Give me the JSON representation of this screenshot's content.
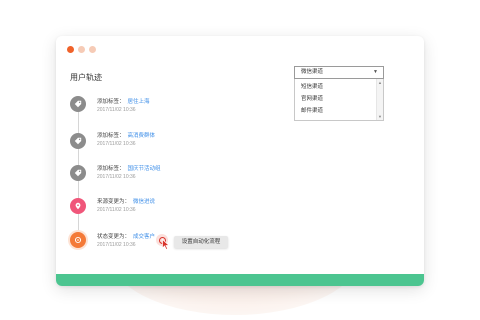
{
  "title": "用户轨迹",
  "channel_select": {
    "selected": "微信渠道",
    "options": [
      "短信渠道",
      "官网渠道",
      "邮件渠道"
    ]
  },
  "timeline": [
    {
      "icon": "tag-icon",
      "label": "添加标签：",
      "value": "居住上海",
      "time": "2017/11/02 10:36"
    },
    {
      "icon": "tag-icon",
      "label": "添加标签：",
      "value": "高消费群体",
      "time": "2017/11/02 10:36"
    },
    {
      "icon": "tag-icon",
      "label": "添加标签：",
      "value": "国庆节活动组",
      "time": "2017/11/02 10:36"
    },
    {
      "icon": "location-pin-icon",
      "label": "来源变更为：",
      "value": "微信进说",
      "time": "2017/11/02 10:36"
    },
    {
      "icon": "status-icon",
      "label": "状态变更为：",
      "value": "成交客户",
      "time": "2017/11/02 10:36"
    }
  ],
  "tooltip": "设置自动化流程",
  "colors": {
    "accent_bar": "#4cc590",
    "link": "#3d8ee8",
    "node_gray": "#8c8c8c",
    "node_pink": "#f0567a",
    "node_orange": "#f47a38",
    "window_dot_red": "#f0622a"
  }
}
